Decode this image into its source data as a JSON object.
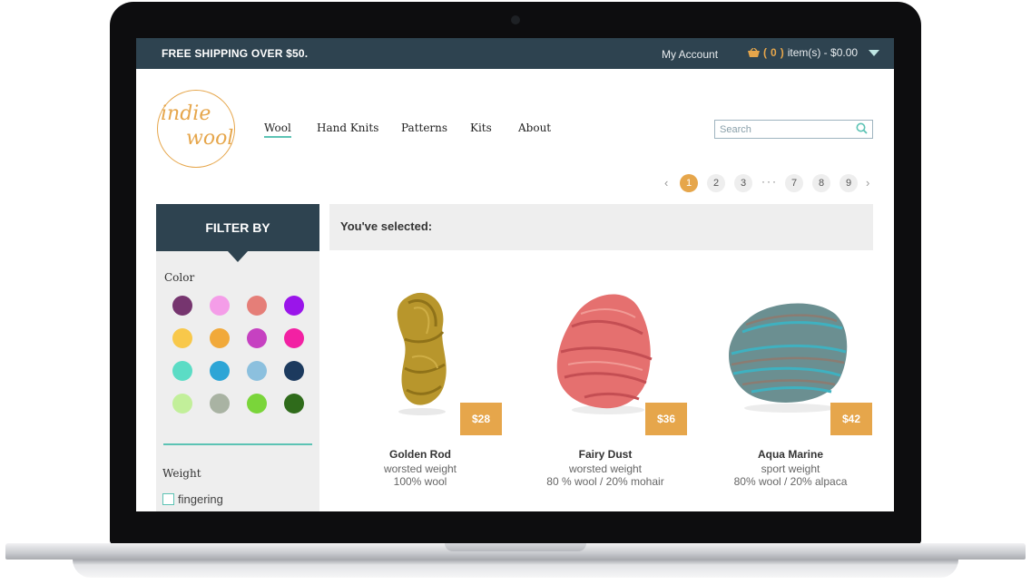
{
  "topbar": {
    "shipping": "FREE SHIPPING OVER $50.",
    "account": "My Account",
    "cart_open": "(",
    "cart_count": "0",
    "cart_close": ")",
    "cart_summary": "item(s) - $0.00"
  },
  "logo": {
    "line1": "indie",
    "line2": "wool"
  },
  "nav": [
    "Wool",
    "Hand Knits",
    "Patterns",
    "Kits",
    "About"
  ],
  "search": {
    "placeholder": "Search"
  },
  "pagination": {
    "pages": [
      "1",
      "2",
      "3",
      "7",
      "8",
      "9"
    ],
    "current": "1",
    "ellipsis": "···"
  },
  "filter": {
    "title": "FILTER BY",
    "color_label": "Color",
    "colors": [
      "#76356f",
      "#f49de8",
      "#e57e78",
      "#9a15ea",
      "#f8c84a",
      "#f1a93a",
      "#c641c1",
      "#f221a3",
      "#5bdcc5",
      "#2da5d6",
      "#8cc0de",
      "#1c3a5e",
      "#c2ef9a",
      "#a9b3a3",
      "#7ad53a",
      "#2f6b1b"
    ],
    "weight_label": "Weight",
    "weight_option": "fingering"
  },
  "selection": {
    "label": "You've selected:"
  },
  "products": [
    {
      "name": "Golden Rod",
      "weight": "worsted weight",
      "fiber": "100% wool",
      "price": "$28"
    },
    {
      "name": "Fairy Dust",
      "weight": "worsted weight",
      "fiber": "80 % wool / 20% mohair",
      "price": "$36"
    },
    {
      "name": "Aqua Marine",
      "weight": "sport weight",
      "fiber": "80% wool / 20% alpaca",
      "price": "$42"
    }
  ],
  "icons": {
    "cart": "basket-icon",
    "dropdown": "caret-down-icon",
    "search": "magnifier-icon"
  }
}
